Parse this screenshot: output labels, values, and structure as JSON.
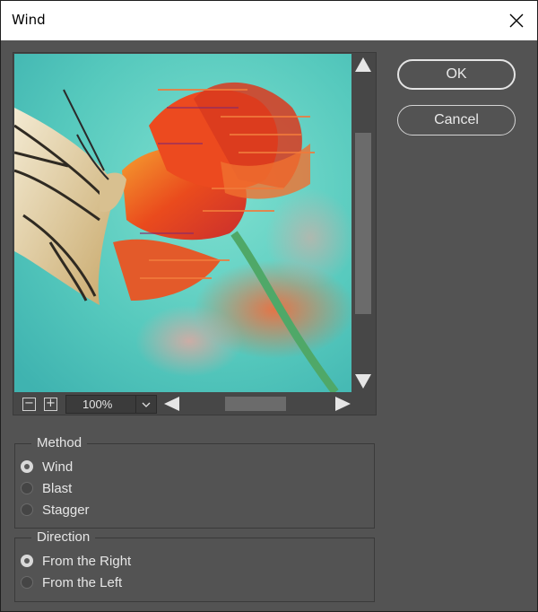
{
  "window": {
    "title": "Wind"
  },
  "preview": {
    "zoom": "100%"
  },
  "buttons": {
    "ok": "OK",
    "cancel": "Cancel"
  },
  "method": {
    "label": "Method",
    "options": [
      "Wind",
      "Blast",
      "Stagger"
    ],
    "selected": "Wind"
  },
  "direction": {
    "label": "Direction",
    "options": [
      "From the Right",
      "From the Left"
    ],
    "selected": "From the Right"
  },
  "colors": {
    "dialog_bg": "#535353",
    "preview_bg": "#5fcfbf",
    "flower": "#e8431f",
    "stem": "#4fa868"
  },
  "icons": [
    "close-icon",
    "zoom-out-icon",
    "zoom-in-icon",
    "chevron-down-icon",
    "scroll-up-arrow-icon",
    "scroll-down-arrow-icon",
    "scroll-left-arrow-icon",
    "scroll-right-arrow-icon"
  ]
}
